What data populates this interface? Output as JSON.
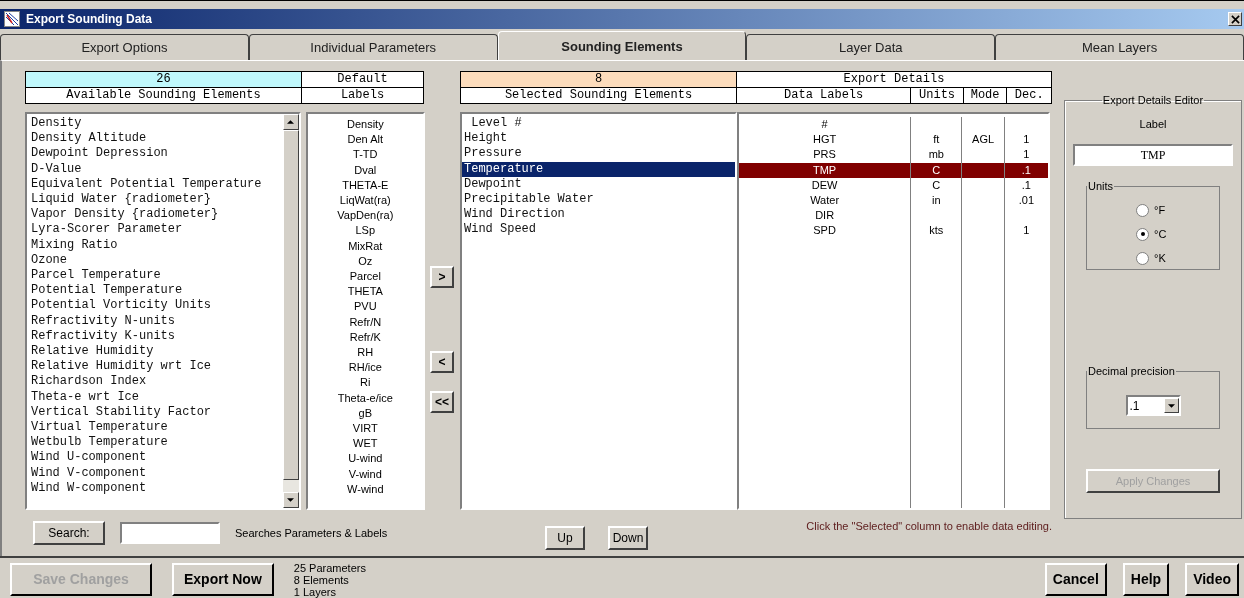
{
  "window": {
    "title": "Export Sounding Data"
  },
  "tabs": [
    {
      "label": "Export Options",
      "selected": false
    },
    {
      "label": "Individual Parameters",
      "selected": false
    },
    {
      "label": "Sounding Elements",
      "selected": true
    },
    {
      "label": "Layer Data",
      "selected": false
    },
    {
      "label": "Mean Layers",
      "selected": false
    }
  ],
  "available": {
    "count": "26",
    "heading": "Available Sounding Elements",
    "labels_heading_top": "Default",
    "labels_heading_bottom": "Labels",
    "items": [
      {
        "name": "Density",
        "label": "Density"
      },
      {
        "name": "Density Altitude",
        "label": "Den Alt"
      },
      {
        "name": "Dewpoint Depression",
        "label": "T-TD"
      },
      {
        "name": "D-Value",
        "label": "Dval"
      },
      {
        "name": "Equivalent Potential Temperature",
        "label": "THETA-E"
      },
      {
        "name": "Liquid Water {radiometer}",
        "label": "LiqWat(ra)"
      },
      {
        "name": "Vapor Density {radiometer}",
        "label": "VapDen(ra)"
      },
      {
        "name": "Lyra-Scorer Parameter",
        "label": "LSp"
      },
      {
        "name": "Mixing Ratio",
        "label": "MixRat"
      },
      {
        "name": "Ozone",
        "label": "Oz"
      },
      {
        "name": "Parcel Temperature",
        "label": "Parcel"
      },
      {
        "name": "Potential Temperature",
        "label": "THETA"
      },
      {
        "name": "Potential Vorticity Units",
        "label": "PVU"
      },
      {
        "name": "Refractivity N-units",
        "label": "Refr/N"
      },
      {
        "name": "Refractivity K-units",
        "label": "Refr/K"
      },
      {
        "name": "Relative Humidity",
        "label": "RH"
      },
      {
        "name": "Relative Humidity wrt Ice",
        "label": "RH/ice"
      },
      {
        "name": "Richardson Index",
        "label": "Ri"
      },
      {
        "name": "Theta-e wrt Ice",
        "label": "Theta-e/ice"
      },
      {
        "name": "Vertical Stability Factor",
        "label": "gB"
      },
      {
        "name": "Virtual Temperature",
        "label": "VIRT"
      },
      {
        "name": "Wetbulb Temperature",
        "label": "WET"
      },
      {
        "name": "Wind U-component",
        "label": "U-wind"
      },
      {
        "name": "Wind V-component",
        "label": "V-wind"
      },
      {
        "name": "Wind W-component",
        "label": "W-wind"
      }
    ]
  },
  "move_buttons": [
    ">",
    "<",
    "<<"
  ],
  "search": {
    "button": "Search:",
    "note": "Searches Parameters & Labels"
  },
  "selected_elements": {
    "count": "8",
    "heading": "Selected Sounding Elements",
    "details_heading": "Export Details",
    "columns": [
      "Data Labels",
      "Units",
      "Mode",
      "Dec."
    ],
    "rows": [
      {
        "name": " Level #",
        "label": "#",
        "selected": false
      },
      {
        "name": "Height",
        "label": "HGT",
        "units": "ft",
        "mode": "AGL",
        "dec": "1",
        "selected": false
      },
      {
        "name": "Pressure",
        "label": "PRS",
        "units": "mb",
        "dec": "1",
        "selected": false
      },
      {
        "name": "Temperature",
        "label": "TMP",
        "units": "C",
        "dec": ".1",
        "selected": true
      },
      {
        "name": "Dewpoint",
        "label": "DEW",
        "units": "C",
        "dec": ".1",
        "selected": false
      },
      {
        "name": "Precipitable Water",
        "label": "Water",
        "units": "in",
        "dec": ".01",
        "selected": false
      },
      {
        "name": "Wind Direction",
        "label": "DIR",
        "selected": false
      },
      {
        "name": "Wind Speed",
        "label": "SPD",
        "units": "kts",
        "dec": "1",
        "selected": false
      }
    ]
  },
  "order_buttons": [
    "Up",
    "Down"
  ],
  "hint": "Click the \"Selected\" column to enable data editing.",
  "editor": {
    "title": "Export Details Editor",
    "label_caption": "Label",
    "label_value": "TMP",
    "units_title": "Units",
    "units": [
      {
        "label": "°F",
        "selected": false
      },
      {
        "label": "°C",
        "selected": true
      },
      {
        "label": "°K",
        "selected": false
      }
    ],
    "precision_title": "Decimal precision",
    "precision": ".1",
    "apply": {
      "label": "Apply Changes",
      "disabled": true
    }
  },
  "footer": {
    "buttons": [
      {
        "label": "Save Changes",
        "disabled": true
      },
      {
        "label": "Export Now",
        "disabled": false
      }
    ],
    "stats": [
      "25 Parameters",
      "8 Elements",
      "1 Layers"
    ],
    "right_buttons": [
      "Cancel",
      "Help",
      "Video"
    ]
  }
}
